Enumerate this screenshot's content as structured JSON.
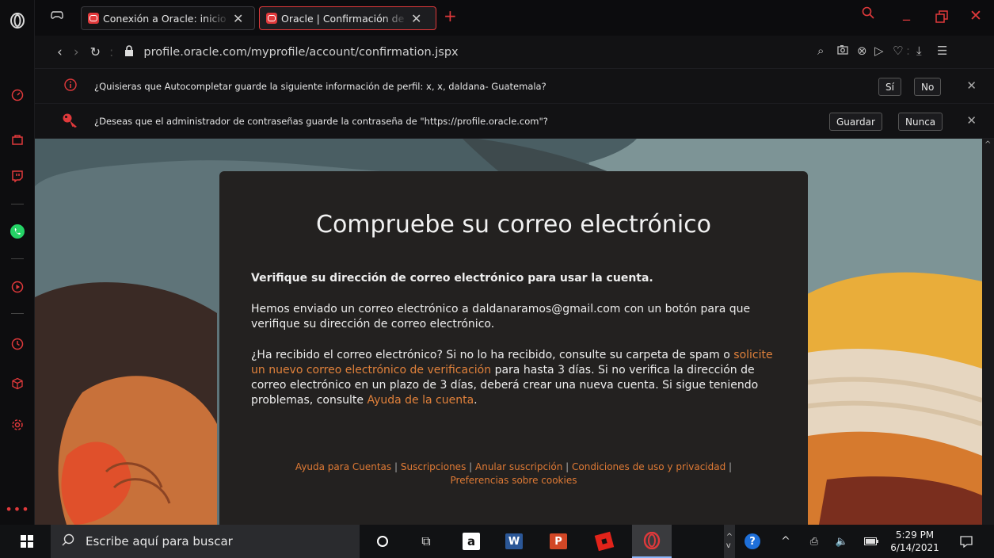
{
  "tabs": [
    {
      "title": "Conexión a Oracle: inicio de sesión",
      "active": false
    },
    {
      "title": "Oracle | Confirmación de cuenta",
      "active": true
    }
  ],
  "address": {
    "url": "profile.oracle.com/myprofile/account/confirmation.jspx"
  },
  "autofill": {
    "message": "¿Quisieras que Autocompletar guarde la siguiente información de perfil: x, x, daldana- Guatemala?",
    "yes_label": "Sí",
    "no_label": "No"
  },
  "password": {
    "message": "¿Deseas que el administrador de contraseñas guarde la contraseña de \"https://profile.oracle.com\"?",
    "save_label": "Guardar",
    "never_label": "Nunca"
  },
  "card": {
    "title": "Compruebe su correo electrónico",
    "intro": "Verifique su dirección de correo electrónico para usar la cuenta.",
    "sent": "Hemos enviado un correo electrónico a daldanaramos@gmail.com con un botón para que verifique su dirección de correo electrónico.",
    "q_part1": "¿Ha recibido el correo electrónico? Si no lo ha recibido, consulte su carpeta de spam o ",
    "q_link1": "solicite un nuevo correo electrónico de verificación",
    "q_part2": " para hasta 3 días. Si no verifica la dirección de correo electrónico en un plazo de 3 días, deberá crear una nueva cuenta. Si sigue teniendo problemas, consulte ",
    "q_link2": "Ayuda de la cuenta",
    "q_part3": "."
  },
  "footer": {
    "links": [
      "Ayuda para Cuentas",
      "Suscripciones",
      "Anular suscripción",
      "Condiciones de uso y privacidad",
      "Preferencias sobre cookies"
    ],
    "sep": " | "
  },
  "taskbar": {
    "search_placeholder": "Escribe aquí para buscar",
    "time": "5:29 PM",
    "date": "6/14/2021"
  },
  "icons": [
    "opera-logo",
    "game-icon",
    "speedometer-icon",
    "bag-icon",
    "twitch-icon",
    "whatsapp-icon",
    "player-icon",
    "clock-icon",
    "cube-icon",
    "settings-icon",
    "more-icon"
  ]
}
